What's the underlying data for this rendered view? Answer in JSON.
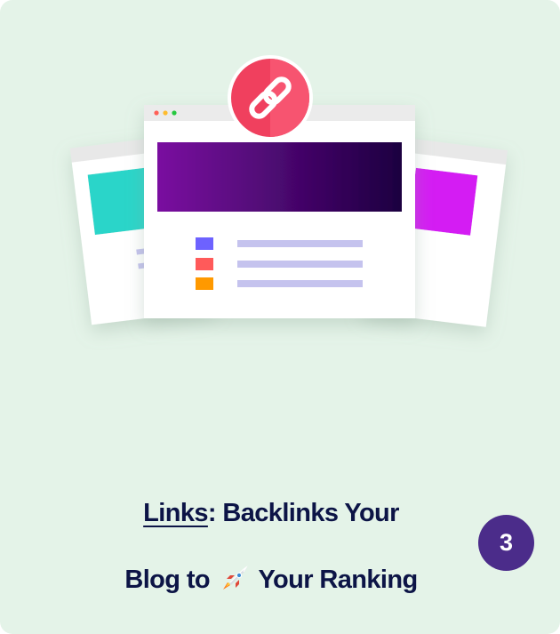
{
  "card": {
    "title_link": "Links",
    "title_rest_line1": ": Backlinks Your",
    "title_line2_before": "Blog to",
    "title_line2_icon": "rocket-emoji-icon",
    "title_line2_after": " Your Ranking",
    "step_number": "3",
    "background_color": "#e4f3e8",
    "accent_color": "#4b2c8a"
  },
  "illustration": {
    "center_icon": "chain-link-icon",
    "window_dots": [
      "#ff5f57",
      "#febc2e",
      "#28c840"
    ],
    "list_bullet_colors": [
      "#6d62ff",
      "#ff5a5a",
      "#ff9900"
    ],
    "left_page_accent": "#2ad5c9",
    "right_page_accent": "#d41ef3",
    "banner_gradient": [
      "#7a0ea0",
      "#1c0040"
    ],
    "link_badge_color": "#f0405e"
  }
}
